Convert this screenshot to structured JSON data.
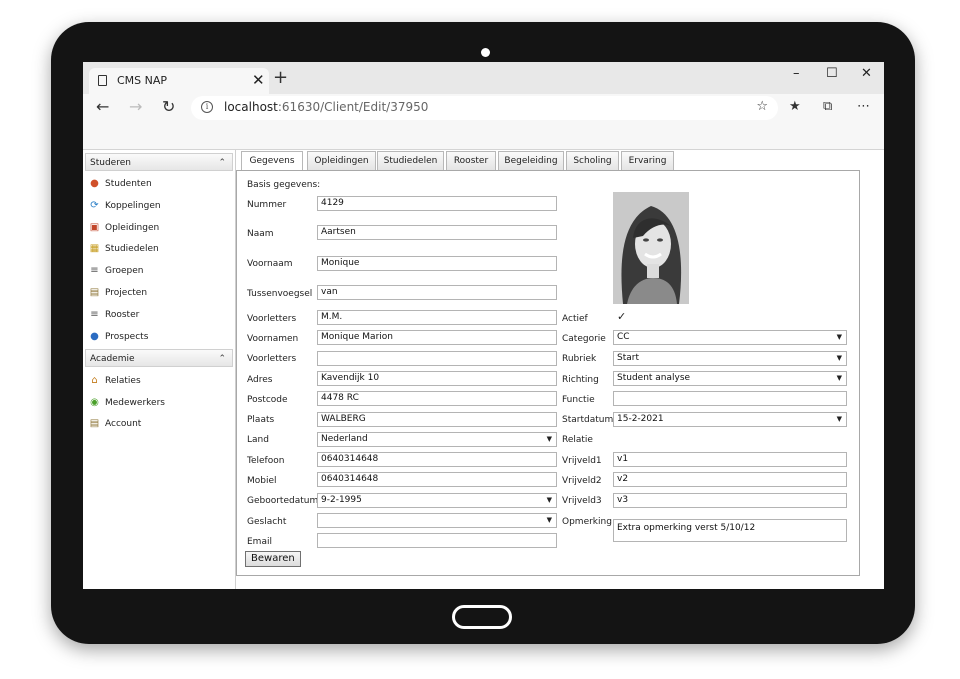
{
  "browser": {
    "tab_title": "CMS NAP",
    "tab_close": "✕",
    "new_tab": "+",
    "url_host": "localhost",
    "url_rest": ":61630/Client/Edit/37950",
    "win_min": "–",
    "win_max": "☐",
    "win_close": "✕"
  },
  "sidebar": {
    "studeren": {
      "header": "Studeren",
      "items": [
        "Studenten",
        "Koppelingen",
        "Opleidingen",
        "Studiedelen",
        "Groepen",
        "Projecten",
        "Rooster",
        "Prospects"
      ]
    },
    "academie": {
      "header": "Academie",
      "items": [
        "Relaties",
        "Medewerkers",
        "Account"
      ]
    }
  },
  "tabs": [
    "Gegevens",
    "Opleidingen",
    "Studiedelen",
    "Rooster",
    "Begeleiding",
    "Scholing",
    "Ervaring"
  ],
  "form": {
    "section_title": "Basis gegevens:",
    "nummer": {
      "label": "Nummer",
      "value": "4129"
    },
    "naam": {
      "label": "Naam",
      "value": "Aartsen"
    },
    "voornaam": {
      "label": "Voornaam",
      "value": "Monique"
    },
    "tussenvoegsel": {
      "label": "Tussenvoegsel",
      "value": "van"
    },
    "voorletters": {
      "label": "Voorletters",
      "value": "M.M."
    },
    "voornamen": {
      "label": "Voornamen",
      "value": "Monique Marion"
    },
    "voorletters2": {
      "label": "Voorletters",
      "value": ""
    },
    "adres": {
      "label": "Adres",
      "value": "Kavendijk 10"
    },
    "postcode": {
      "label": "Postcode",
      "value": "4478 RC"
    },
    "plaats": {
      "label": "Plaats",
      "value": "WALBERG"
    },
    "land": {
      "label": "Land",
      "value": "Nederland"
    },
    "telefoon": {
      "label": "Telefoon",
      "value": "0640314648"
    },
    "mobiel": {
      "label": "Mobiel",
      "value": "0640314648"
    },
    "geboortedatum": {
      "label": "Geboortedatum",
      "value": "9-2-1995"
    },
    "geslacht": {
      "label": "Geslacht",
      "value": ""
    },
    "email": {
      "label": "Email",
      "value": ""
    },
    "actief": {
      "label": "Actief",
      "checked": "✓"
    },
    "categorie": {
      "label": "Categorie",
      "value": "CC"
    },
    "rubriek": {
      "label": "Rubriek",
      "value": "Start"
    },
    "richting": {
      "label": "Richting",
      "value": "Student analyse"
    },
    "functie": {
      "label": "Functie",
      "value": ""
    },
    "startdatum": {
      "label": "Startdatum",
      "value": "15-2-2021"
    },
    "relatie": {
      "label": "Relatie"
    },
    "vrijveld1": {
      "label": "Vrijveld1",
      "value": "v1"
    },
    "vrijveld2": {
      "label": "Vrijveld2",
      "value": "v2"
    },
    "vrijveld3": {
      "label": "Vrijveld3",
      "value": "v3"
    },
    "opmerking": {
      "label": "Opmerking",
      "value": "Extra opmerking verst 5/10/12"
    },
    "save_label": "Bewaren"
  }
}
